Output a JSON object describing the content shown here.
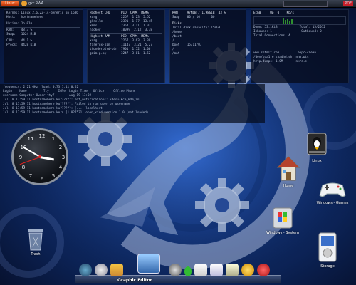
{
  "topbar": {
    "start_label": "Linux",
    "task_label": "gkr RWA",
    "indicator_text": "PDF"
  },
  "monitors": {
    "system": {
      "rows": [
        "Kernel: Linux 2.6.22-14-generic on i686",
        "Host:   hostnamehere",
        "",
        "Uptime: 1h 01m",
        "",
        "RAM:    48.3 %",
        "Swap:   1024 MiB",
        "",
        "CPU:    44.1 %",
        "Procs:  4428 KiB"
      ]
    },
    "processes": {
      "header": "Highest CPU      PID  CPU%  MEM%",
      "rows": [
        "xorg             2267  1.23  5.52",
        "gkrellm          2391  1.17  13.45",
        "xmms             2354  3.11  1.02",
        "nicker           10099  2.12  3.38",
        "",
        "Highest RAM      PID  CPU%  MEM%",
        "xorg             2267  3.63  3.39",
        "firefox-bin      11147  3.21  5.27",
        "thunderbird-bin  7901  1.52  1.06",
        "gaim-p.py        3247  3.81  1.52"
      ]
    },
    "network": {
      "header": "RAM     97MiB / 1.98GiB  43 %",
      "rows": [
        "Swap    00 / 1G      00",
        "",
        "Disks",
        "Total disk capacity: 150GB",
        "",
        "/home",
        "/boot    ",
        "/        ",
        "",
        "boot    15/11/07",
        "",
        "/         ",
        "         ",
        "/mnt    "
      ]
    },
    "cpu": {
      "header": "Eth0     Up  0    Kb/s",
      "rows": [
        "Down: 53.1KiB            Total: 15/2012",
        "Inbound: 1                Outbound: 0",
        "Total Connections: 4",
        "",
        "",
        "",
        "",
        "",
        "",
        "",
        "www.shtmlt.com          eepc-clean",
        "/dev/sda1_e_sbadhd.sh  nhm.pts",
        "http.dumps: 1.0M       nkrd.e"
      ]
    }
  },
  "terminal": {
    "rows": [
      "frequency: 2.21 GHz  load: 0.73 1.11 0.52",
      "",
      "Login    Name         Tty     Idle  Login Time   Office     Office Phone",
      "username Computer Owner tty7        Aug 19 13:02",
      "Jul  8 17:59:11 hostnamehere ku??????: Dot_notifications: kdesu(kcm_kdm_ini...",
      "Jul  8 17:59:11 hostnamehere ku??????: Failed to run user by username",
      "Jul  8 17:59:11 hostnamehere ku??????: [...] localhost",
      "Jul  8 17:59:11 hostnamehere kern [1.027531] open_xfsd version 1.0 (not loaded)"
    ]
  },
  "clock": {
    "numbers": [
      "12",
      "1",
      "2",
      "3",
      "4",
      "5",
      "6",
      "7",
      "8",
      "9",
      "10",
      "11"
    ],
    "hour_deg": 100,
    "minute_deg": 300,
    "second_deg": 250
  },
  "desktop_icons": {
    "trash": "Trash",
    "linux": "Linux",
    "home": "Home",
    "windows_games": "Windows - Games",
    "windows_system": "Windows - System",
    "storage": "Storage"
  },
  "dock": {
    "active_label": "Graphic Editor"
  },
  "colors": {
    "accent": "#ff6a1a",
    "background": "#163d8e",
    "gear": "#b9c6de"
  }
}
